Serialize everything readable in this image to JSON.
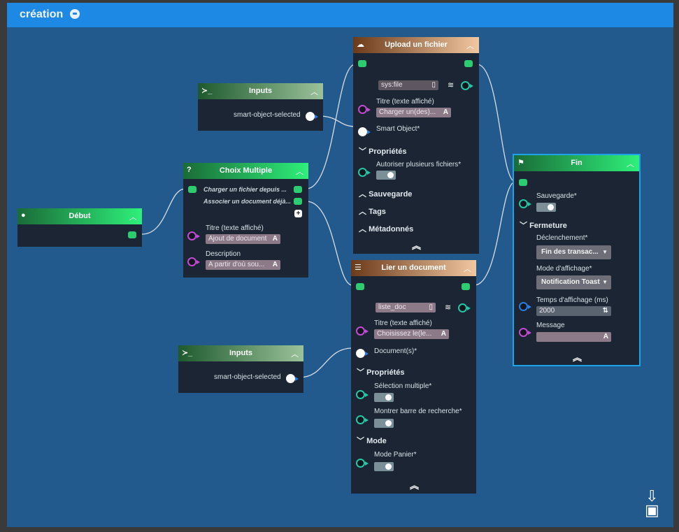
{
  "app": {
    "title": "création"
  },
  "debut": {
    "title": "Début"
  },
  "inputs1": {
    "title": "Inputs",
    "output": "smart-object-selected"
  },
  "inputs2": {
    "title": "Inputs",
    "output": "smart-object-selected"
  },
  "choix": {
    "title": "Choix Multiple",
    "options": [
      "Charger un fichier depuis ...",
      "Associer un document déjà..."
    ],
    "titre_label": "Titre (texte affiché)",
    "titre_value": "Ajout de document",
    "description_label": "Description",
    "description_value": "A partir d'où sou..."
  },
  "upload": {
    "title": "Upload un fichier",
    "sysfile": "sys:file",
    "titre_label": "Titre (texte affiché)",
    "titre_value": "Charger un(des)...",
    "smart_object_label": "Smart Object*",
    "proprietes": "Propriétés",
    "autoriser_label": "Autoriser plusieurs fichiers*",
    "sauvegarde": "Sauvegarde",
    "tags": "Tags",
    "metadonnees": "Métadonnés"
  },
  "lier": {
    "title": "Lier un document",
    "liste": "liste_doc",
    "titre_label": "Titre (texte affiché)",
    "titre_value": "Choisissez le(le...",
    "documents_label": "Document(s)*",
    "proprietes": "Propriétés",
    "selection_label": "Sélection multiple*",
    "montrer_label": "Montrer barre de recherche*",
    "mode": "Mode",
    "mode_panier_label": "Mode Panier*"
  },
  "fin": {
    "title": "Fin",
    "sauvegarde_label": "Sauvegarde*",
    "fermeture": "Fermeture",
    "declenchement_label": "Déclenchement*",
    "declenchement_value": "Fin des transac...",
    "mode_affichage_label": "Mode d'affichage*",
    "mode_affichage_value": "Notification Toast",
    "temps_label": "Temps d'affichage (ms)",
    "temps_value": "2000",
    "message_label": "Message"
  }
}
